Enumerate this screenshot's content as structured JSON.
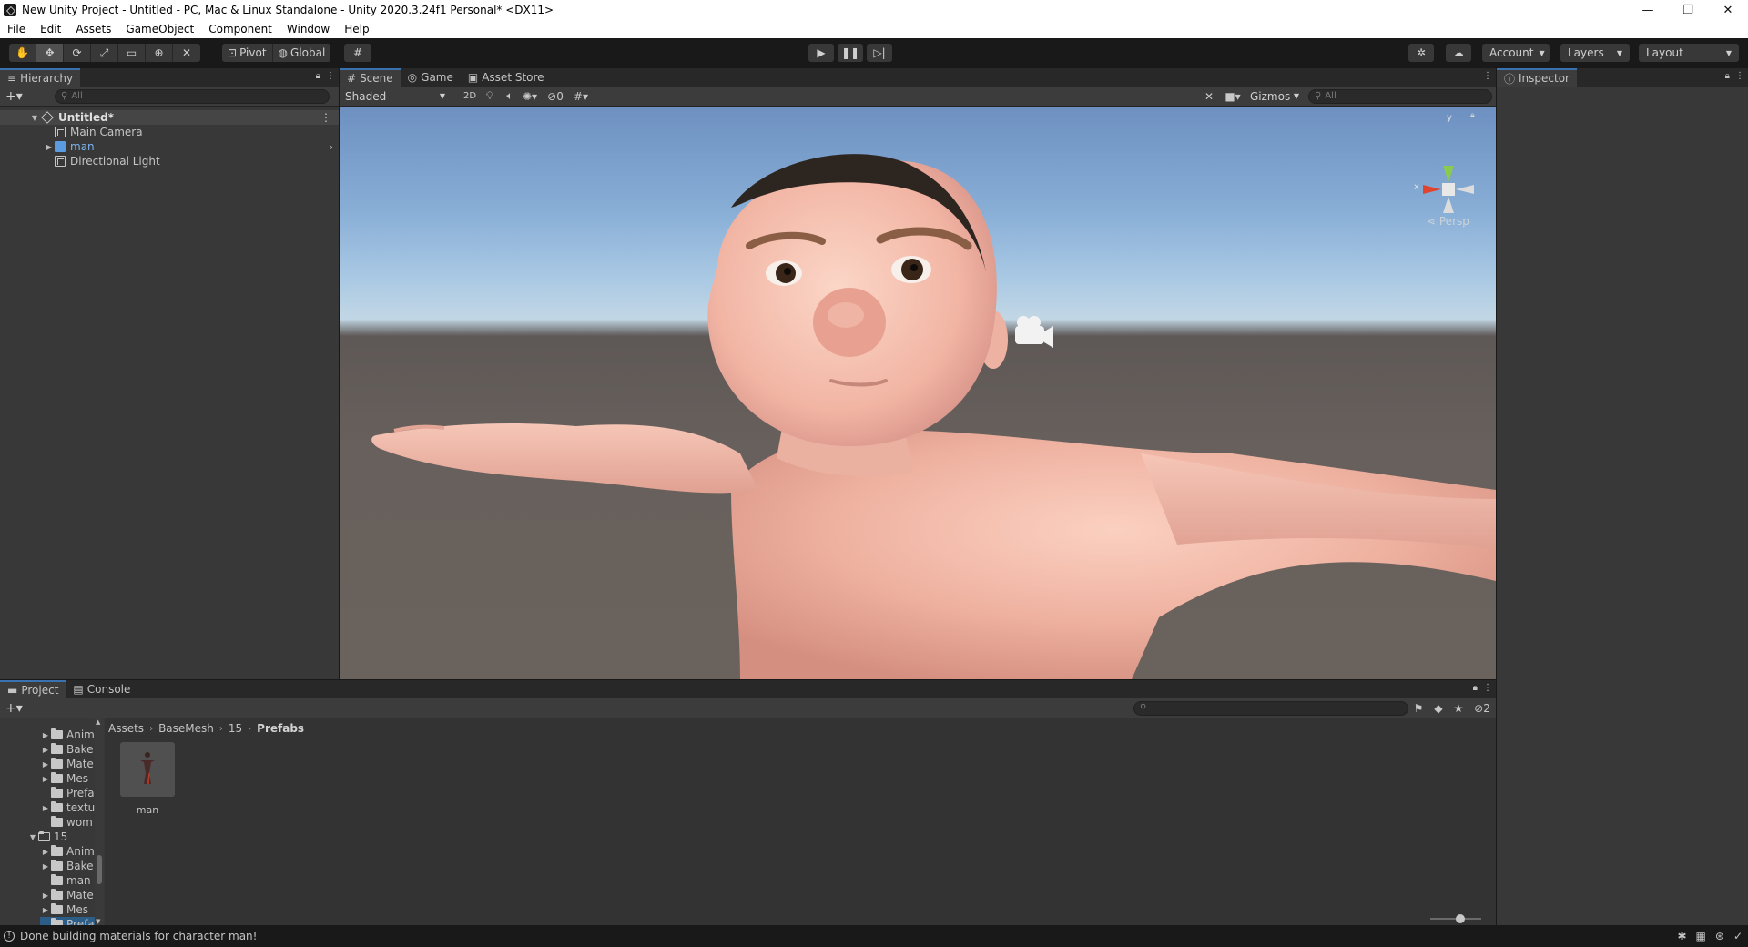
{
  "window": {
    "title": "New Unity Project - Untitled - PC, Mac & Linux Standalone - Unity 2020.3.24f1 Personal* <DX11>",
    "minimize": "—",
    "maximize": "❐",
    "close": "✕"
  },
  "menu": [
    "File",
    "Edit",
    "Assets",
    "GameObject",
    "Component",
    "Window",
    "Help"
  ],
  "toolbar": {
    "pivot_label": "Pivot",
    "global_label": "Global",
    "account_label": "Account",
    "layers_label": "Layers",
    "layout_label": "Layout"
  },
  "hierarchy": {
    "tab_label": "Hierarchy",
    "search_placeholder": "All",
    "scene_name": "Untitled*",
    "items": [
      {
        "label": "Main Camera"
      },
      {
        "label": "man"
      },
      {
        "label": "Directional Light"
      }
    ]
  },
  "scene": {
    "tabs": [
      "Scene",
      "Game",
      "Asset Store"
    ],
    "shading_mode": "Shaded",
    "mode_2d": "2D",
    "hidden_count": "0",
    "gizmos_label": "Gizmos",
    "search_placeholder": "All",
    "gizmo_y": "y",
    "gizmo_x": "x",
    "persp_label": "Persp"
  },
  "inspector": {
    "tab_label": "Inspector"
  },
  "project": {
    "tabs": [
      "Project",
      "Console"
    ],
    "hidden_count": "2",
    "folders": [
      {
        "label": "Anim",
        "expanded": false
      },
      {
        "label": "Bake",
        "expanded": false
      },
      {
        "label": "Mate",
        "expanded": false
      },
      {
        "label": "Mes",
        "expanded": false
      },
      {
        "label": "Prefa",
        "expanded": null
      },
      {
        "label": "textu",
        "expanded": false
      },
      {
        "label": "wom",
        "expanded": null
      },
      {
        "label": "15",
        "expanded": true
      },
      {
        "label": "Anim",
        "expanded": false
      },
      {
        "label": "Bake",
        "expanded": false
      },
      {
        "label": "man",
        "expanded": null
      },
      {
        "label": "Mate",
        "expanded": false
      },
      {
        "label": "Mes",
        "expanded": false
      },
      {
        "label": "Prefa",
        "expanded": null
      }
    ],
    "breadcrumb": [
      "Assets",
      "BaseMesh",
      "15",
      "Prefabs"
    ],
    "assets": [
      {
        "label": "man"
      }
    ]
  },
  "status": {
    "message": "Done building materials for character man!"
  },
  "colors": {
    "skin": "#f0b3a4",
    "sky_top": "#6d90c1",
    "ground": "#655d59",
    "accent": "#3a72b0"
  }
}
